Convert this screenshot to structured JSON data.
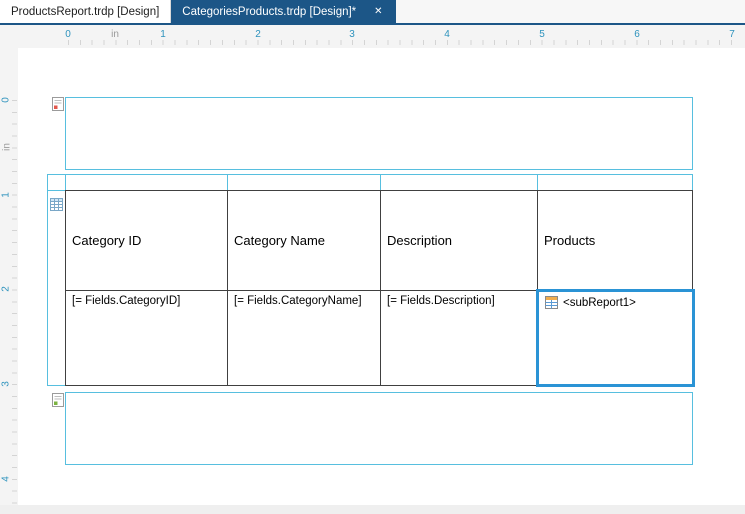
{
  "tabs": [
    {
      "label": "ProductsReport.trdp [Design]",
      "active": false
    },
    {
      "label": "CategoriesProducts.trdp [Design]*",
      "active": true
    }
  ],
  "icons": {
    "close": "✕"
  },
  "ruler": {
    "unit": "in",
    "h_labels": [
      "0",
      "1",
      "2",
      "3",
      "4",
      "5",
      "6",
      "7"
    ],
    "v_labels": [
      "0",
      "1",
      "2",
      "3",
      "4"
    ]
  },
  "report": {
    "table": {
      "headers": [
        "Category ID",
        "Category Name",
        "Description",
        "Products"
      ],
      "details": [
        "[= Fields.CategoryID]",
        "[= Fields.CategoryName]",
        "[= Fields.Description]"
      ],
      "subreport_label": "<subReport1>"
    }
  },
  "colors": {
    "active_tab": "#1c5687",
    "guide": "#57bfdf",
    "selection": "#2a93d5",
    "ruler_text": "#2e93bd",
    "table_border": "#404040"
  }
}
